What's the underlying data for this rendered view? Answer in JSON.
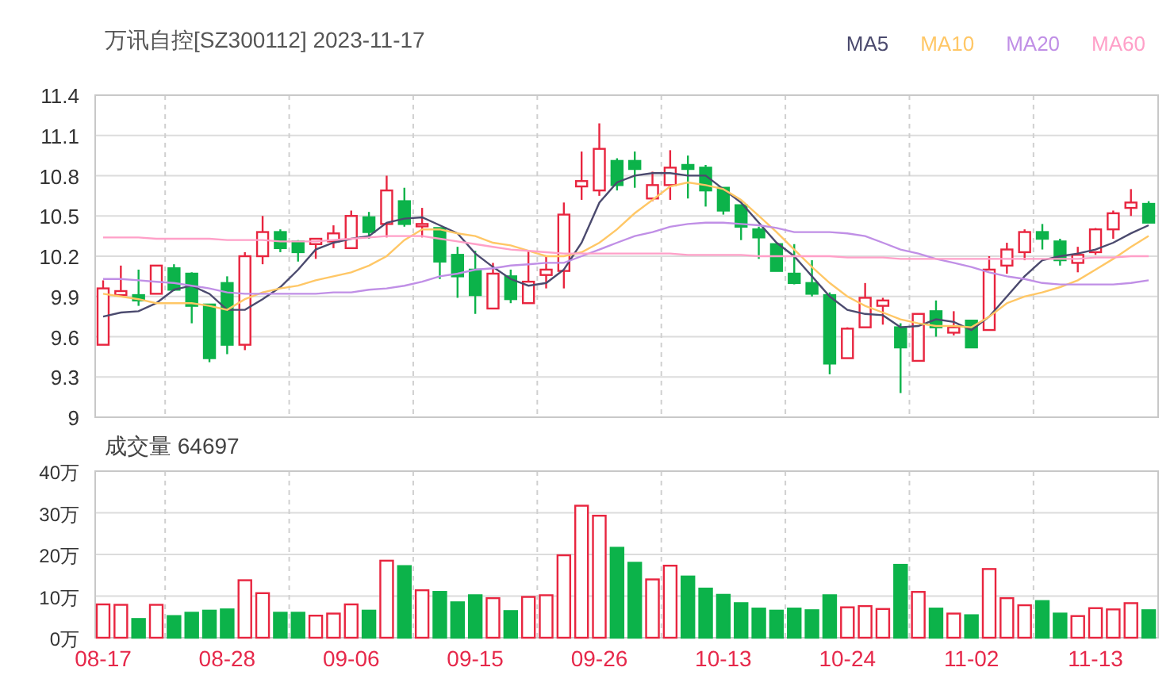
{
  "price_chart": {
    "title": "万讯自控[SZ300112] 2023-11-17",
    "chart_data": {
      "type": "candlestick",
      "grid": true,
      "ylim": [
        9,
        11.4
      ],
      "yticks": [
        {
          "value": 9,
          "label": "9"
        },
        {
          "value": 9.3,
          "label": "9.3"
        },
        {
          "value": 9.6,
          "label": "9.6"
        },
        {
          "value": 9.9,
          "label": "9.9"
        },
        {
          "value": 10.2,
          "label": "10.2"
        },
        {
          "value": 10.5,
          "label": "10.5"
        },
        {
          "value": 10.8,
          "label": "10.8"
        },
        {
          "value": 11.1,
          "label": "11.1"
        },
        {
          "value": 11.4,
          "label": "11.4"
        }
      ],
      "series": [
        {
          "name": "MA5",
          "type": "line",
          "color": "#4b4a6e",
          "values": [
            9.75,
            9.78,
            9.79,
            9.85,
            9.95,
            9.98,
            9.92,
            9.8,
            9.8,
            9.88,
            9.97,
            10.1,
            10.25,
            10.3,
            10.33,
            10.35,
            10.45,
            10.48,
            10.49,
            10.43,
            10.37,
            10.22,
            10.12,
            10.03,
            9.98,
            10.0,
            10.1,
            10.3,
            10.6,
            10.75,
            10.8,
            10.82,
            10.82,
            10.8,
            10.8,
            10.7,
            10.6,
            10.45,
            10.3,
            10.2,
            10.05,
            9.9,
            9.8,
            9.77,
            9.76,
            9.67,
            9.68,
            9.73,
            9.71,
            9.65,
            9.75,
            9.9,
            10.05,
            10.17,
            10.2,
            10.22,
            10.25,
            10.3,
            10.37,
            10.43
          ]
        },
        {
          "name": "MA10",
          "type": "line",
          "color": "#ffc766",
          "values": [
            9.92,
            9.9,
            9.88,
            9.85,
            9.85,
            9.85,
            9.83,
            9.8,
            9.88,
            9.93,
            9.96,
            9.98,
            10.02,
            10.05,
            10.08,
            10.13,
            10.2,
            10.32,
            10.4,
            10.4,
            10.37,
            10.35,
            10.3,
            10.28,
            10.24,
            10.2,
            10.2,
            10.23,
            10.3,
            10.4,
            10.52,
            10.62,
            10.72,
            10.75,
            10.73,
            10.7,
            10.62,
            10.5,
            10.38,
            10.25,
            10.12,
            10.0,
            9.9,
            9.83,
            9.78,
            9.73,
            9.7,
            9.68,
            9.68,
            9.67,
            9.75,
            9.85,
            9.9,
            9.93,
            9.97,
            10.02,
            10.1,
            10.18,
            10.27,
            10.35
          ]
        },
        {
          "name": "MA20",
          "type": "line",
          "color": "#c08fe6",
          "values": [
            10.03,
            10.03,
            10.02,
            10.01,
            10.0,
            9.98,
            9.96,
            9.93,
            9.92,
            9.92,
            9.92,
            9.92,
            9.92,
            9.93,
            9.93,
            9.95,
            9.96,
            9.98,
            10.01,
            10.05,
            10.07,
            10.1,
            10.11,
            10.13,
            10.14,
            10.15,
            10.15,
            10.2,
            10.25,
            10.3,
            10.35,
            10.38,
            10.42,
            10.44,
            10.45,
            10.45,
            10.44,
            10.43,
            10.41,
            10.38,
            10.38,
            10.38,
            10.37,
            10.35,
            10.3,
            10.25,
            10.22,
            10.18,
            10.15,
            10.12,
            10.08,
            10.05,
            10.03,
            10.0,
            9.99,
            9.99,
            9.99,
            9.99,
            10.0,
            10.02
          ]
        },
        {
          "name": "MA60",
          "type": "line",
          "color": "#ffa0c8",
          "values": [
            10.34,
            10.34,
            10.34,
            10.33,
            10.33,
            10.33,
            10.33,
            10.32,
            10.32,
            10.32,
            10.31,
            10.31,
            10.31,
            10.32,
            10.33,
            10.34,
            10.35,
            10.35,
            10.35,
            10.33,
            10.31,
            10.29,
            10.27,
            10.25,
            10.24,
            10.23,
            10.22,
            10.22,
            10.22,
            10.22,
            10.22,
            10.22,
            10.22,
            10.21,
            10.21,
            10.21,
            10.21,
            10.2,
            10.2,
            10.2,
            10.2,
            10.2,
            10.19,
            10.19,
            10.19,
            10.18,
            10.18,
            10.18,
            10.18,
            10.18,
            10.18,
            10.18,
            10.18,
            10.18,
            10.18,
            10.18,
            10.19,
            10.19,
            10.2,
            10.2
          ]
        }
      ],
      "ohlc": [
        [
          9.54,
          10.02,
          9.54,
          9.96
        ],
        [
          9.91,
          10.13,
          9.9,
          9.94
        ],
        [
          9.91,
          10.1,
          9.83,
          9.87
        ],
        [
          9.92,
          10.13,
          9.92,
          10.13
        ],
        [
          10.11,
          10.14,
          9.94,
          9.95
        ],
        [
          10.07,
          10.08,
          9.7,
          9.83
        ],
        [
          9.84,
          9.84,
          9.41,
          9.44
        ],
        [
          10.0,
          10.05,
          9.47,
          9.54
        ],
        [
          9.54,
          10.23,
          9.5,
          10.2
        ],
        [
          10.2,
          10.5,
          10.14,
          10.38
        ],
        [
          10.38,
          10.4,
          10.23,
          10.26
        ],
        [
          10.31,
          10.32,
          10.16,
          10.23
        ],
        [
          10.29,
          10.33,
          10.18,
          10.33
        ],
        [
          10.31,
          10.43,
          10.26,
          10.37
        ],
        [
          10.26,
          10.54,
          10.26,
          10.5
        ],
        [
          10.49,
          10.53,
          10.33,
          10.38
        ],
        [
          10.44,
          10.8,
          10.34,
          10.69
        ],
        [
          10.61,
          10.71,
          10.42,
          10.44
        ],
        [
          10.43,
          10.56,
          10.34,
          10.44
        ],
        [
          10.41,
          10.41,
          10.03,
          10.16
        ],
        [
          10.21,
          10.27,
          9.89,
          10.05
        ],
        [
          10.1,
          10.24,
          9.77,
          9.91
        ],
        [
          9.81,
          10.15,
          9.81,
          10.07
        ],
        [
          10.05,
          10.1,
          9.85,
          9.88
        ],
        [
          9.85,
          10.24,
          9.85,
          10.01
        ],
        [
          10.06,
          10.2,
          9.96,
          10.1
        ],
        [
          10.09,
          10.6,
          9.96,
          10.51
        ],
        [
          10.72,
          10.98,
          10.62,
          10.76
        ],
        [
          10.69,
          11.19,
          10.65,
          11.0
        ],
        [
          10.91,
          10.93,
          10.69,
          10.73
        ],
        [
          10.91,
          10.98,
          10.71,
          10.85
        ],
        [
          10.63,
          10.83,
          10.61,
          10.73
        ],
        [
          10.73,
          10.99,
          10.62,
          10.86
        ],
        [
          10.88,
          10.95,
          10.63,
          10.85
        ],
        [
          10.86,
          10.88,
          10.57,
          10.69
        ],
        [
          10.71,
          10.71,
          10.51,
          10.54
        ],
        [
          10.58,
          10.58,
          10.32,
          10.42
        ],
        [
          10.4,
          10.42,
          10.18,
          10.34
        ],
        [
          10.29,
          10.29,
          10.09,
          10.09
        ],
        [
          10.07,
          10.29,
          9.99,
          10.0
        ],
        [
          10.0,
          10.17,
          9.9,
          9.92
        ],
        [
          9.91,
          9.93,
          9.32,
          9.4
        ],
        [
          9.44,
          9.67,
          9.44,
          9.66
        ],
        [
          9.67,
          10.0,
          9.67,
          9.89
        ],
        [
          9.83,
          9.89,
          9.69,
          9.87
        ],
        [
          9.67,
          9.7,
          9.18,
          9.52
        ],
        [
          9.42,
          9.77,
          9.42,
          9.77
        ],
        [
          9.79,
          9.87,
          9.6,
          9.67
        ],
        [
          9.63,
          9.79,
          9.61,
          9.67
        ],
        [
          9.72,
          9.72,
          9.52,
          9.52
        ],
        [
          9.65,
          10.2,
          9.65,
          10.1
        ],
        [
          10.13,
          10.3,
          10.07,
          10.25
        ],
        [
          10.23,
          10.4,
          10.17,
          10.38
        ],
        [
          10.38,
          10.44,
          10.25,
          10.33
        ],
        [
          10.31,
          10.33,
          10.13,
          10.17
        ],
        [
          10.15,
          10.27,
          10.08,
          10.21
        ],
        [
          10.23,
          10.41,
          10.21,
          10.4
        ],
        [
          10.4,
          10.54,
          10.33,
          10.52
        ],
        [
          10.56,
          10.7,
          10.5,
          10.6
        ],
        [
          10.59,
          10.61,
          10.45,
          10.45
        ]
      ]
    }
  },
  "volume_chart": {
    "title": "成交量 64697",
    "chart_data": {
      "type": "bar",
      "grid": true,
      "ylim": [
        0,
        40
      ],
      "yticks": [
        {
          "value": 0,
          "label": "0万"
        },
        {
          "value": 10,
          "label": "10万"
        },
        {
          "value": 20,
          "label": "20万"
        },
        {
          "value": 30,
          "label": "30万"
        },
        {
          "value": 40,
          "label": "40万"
        }
      ],
      "categories": [
        "08-17",
        null,
        null,
        null,
        null,
        null,
        null,
        "08-28",
        null,
        null,
        null,
        null,
        null,
        null,
        "09-06",
        null,
        null,
        null,
        null,
        null,
        null,
        "09-15",
        null,
        null,
        null,
        null,
        null,
        null,
        "09-26",
        null,
        null,
        null,
        null,
        null,
        null,
        "10-13",
        null,
        null,
        null,
        null,
        null,
        null,
        "10-24",
        null,
        null,
        null,
        null,
        null,
        null,
        "11-02",
        null,
        null,
        null,
        null,
        null,
        null,
        "11-13",
        null,
        null,
        null
      ],
      "values": [
        8.0,
        7.9,
        4.5,
        7.9,
        5.2,
        6.0,
        6.5,
        6.8,
        13.8,
        10.7,
        6.0,
        6.0,
        5.3,
        5.8,
        8.0,
        6.5,
        18.5,
        17.2,
        11.4,
        11.0,
        8.5,
        10.2,
        9.5,
        6.4,
        9.8,
        10.2,
        19.8,
        31.7,
        29.3,
        21.6,
        18.0,
        14.0,
        17.3,
        14.7,
        11.8,
        10.3,
        8.3,
        7.0,
        6.5,
        7.0,
        6.6,
        10.2,
        7.3,
        7.6,
        6.9,
        17.5,
        11.0,
        7.0,
        5.8,
        5.4,
        16.5,
        9.5,
        7.8,
        8.8,
        5.8,
        5.2,
        7.1,
        6.8,
        8.3,
        6.6
      ]
    }
  }
}
